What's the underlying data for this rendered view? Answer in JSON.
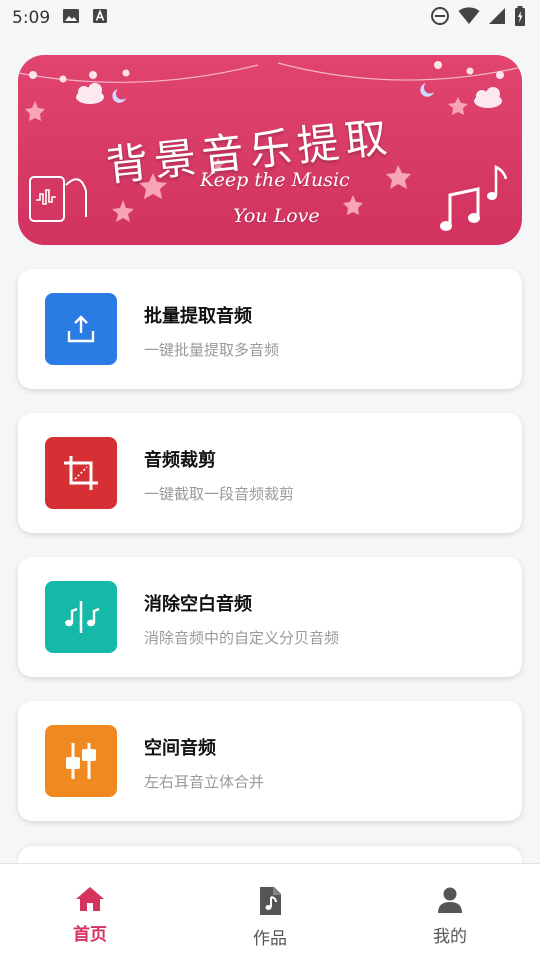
{
  "status": {
    "time": "5:09"
  },
  "banner": {
    "title": "背景音乐提取",
    "subtitle_line1": "Keep the Music",
    "subtitle_line2": "You Love"
  },
  "features": [
    {
      "title": "批量提取音频",
      "subtitle": "一键批量提取多音频",
      "color": "#2a7be4",
      "icon": "upload-icon"
    },
    {
      "title": "音频裁剪",
      "subtitle": "一键截取一段音频裁剪",
      "color": "#d62f34",
      "icon": "crop-icon"
    },
    {
      "title": "消除空白音频",
      "subtitle": "消除音频中的自定义分贝音频",
      "color": "#16b8a7",
      "icon": "music-split-icon"
    },
    {
      "title": "空间音频",
      "subtitle": "左右耳音立体合并",
      "color": "#f08a20",
      "icon": "equalizer-icon"
    }
  ],
  "tabs": [
    {
      "label": "首页",
      "icon": "home-icon",
      "active": true
    },
    {
      "label": "作品",
      "icon": "music-file-icon",
      "active": false
    },
    {
      "label": "我的",
      "icon": "person-icon",
      "active": false
    }
  ],
  "colors": {
    "accent": "#d6335f",
    "banner": "#d73a65"
  }
}
